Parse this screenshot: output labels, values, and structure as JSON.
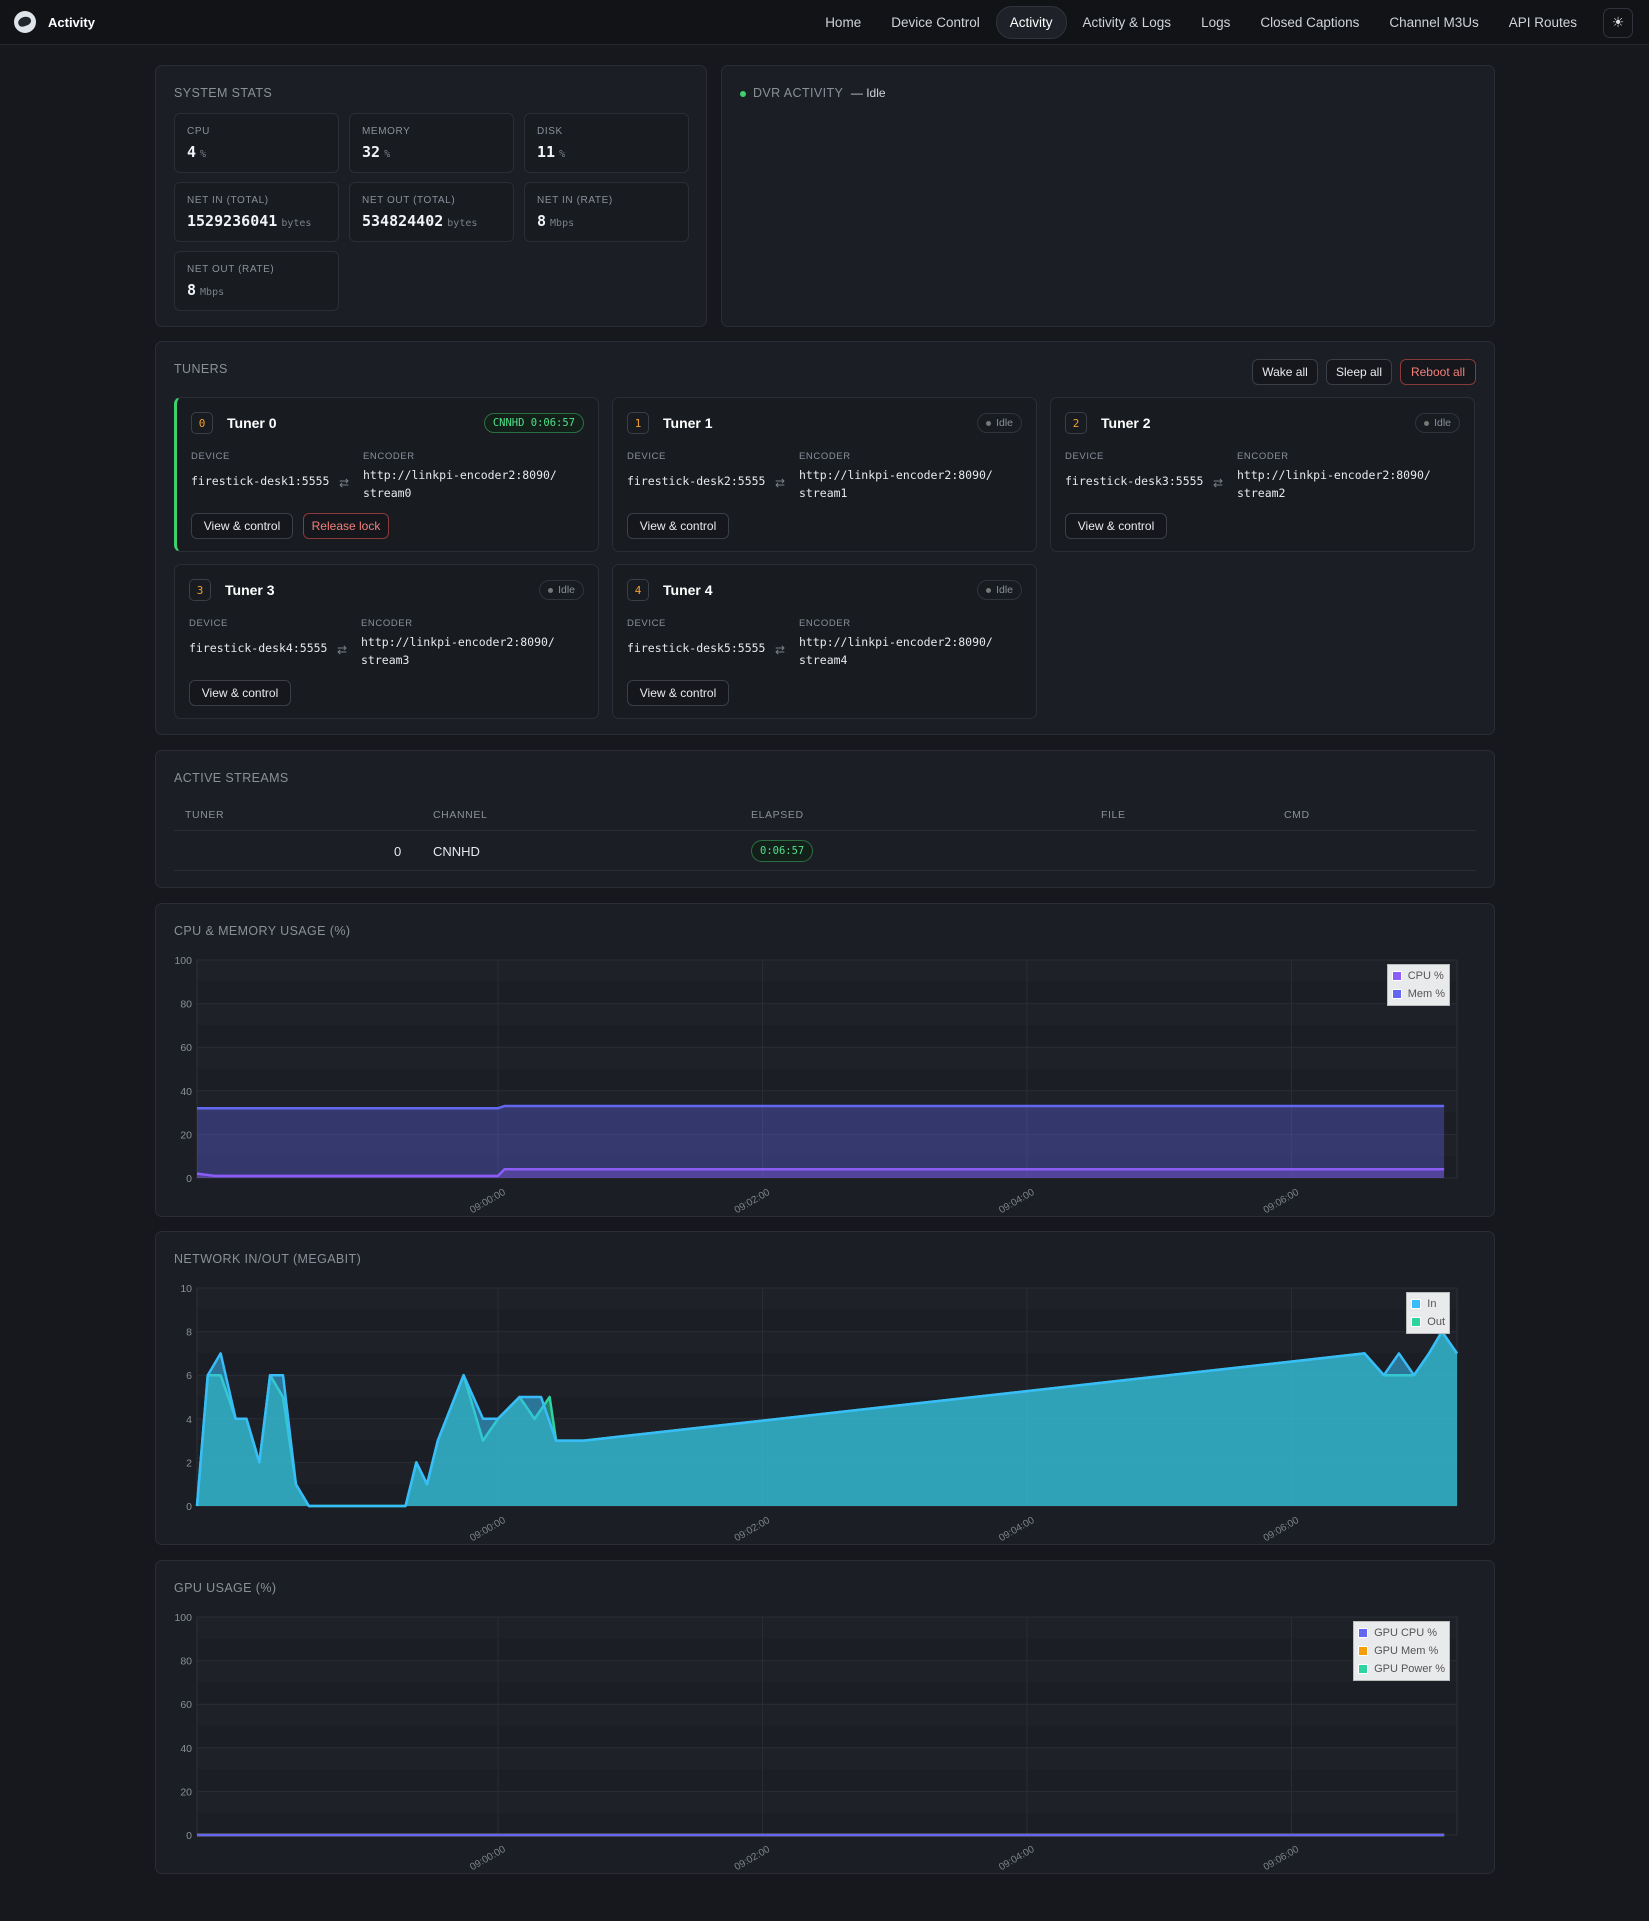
{
  "app": {
    "title": "Activity"
  },
  "nav": {
    "items": [
      "Home",
      "Device Control",
      "Activity",
      "Activity & Logs",
      "Logs",
      "Closed Captions",
      "Channel M3Us",
      "API Routes"
    ],
    "active": "Activity",
    "theme_icon": "sun-icon"
  },
  "system_stats": {
    "title": "System stats",
    "stats": [
      {
        "label": "CPU",
        "value": "4",
        "unit": "%"
      },
      {
        "label": "MEMORY",
        "value": "32",
        "unit": "%"
      },
      {
        "label": "DISK",
        "value": "11",
        "unit": "%"
      },
      {
        "label": "NET IN (TOTAL)",
        "value": "1529236041",
        "unit": "bytes"
      },
      {
        "label": "NET OUT (TOTAL)",
        "value": "534824402",
        "unit": "bytes"
      },
      {
        "label": "NET IN (RATE)",
        "value": "8",
        "unit": "Mbps"
      },
      {
        "label": "NET OUT (RATE)",
        "value": "8",
        "unit": "Mbps"
      }
    ]
  },
  "dvr": {
    "title": "DVR ACTIVITY",
    "status": "— Idle",
    "status_color": "#3ecf6e"
  },
  "tuners": {
    "title": "Tuners",
    "actions": {
      "wake_all": "Wake all",
      "sleep_all": "Sleep all",
      "reboot_all": "Reboot all"
    },
    "labels": {
      "device": "DEVICE",
      "encoder": "ENCODER",
      "view": "View & control",
      "release": "Release lock"
    },
    "list": [
      {
        "num": "0",
        "name": "Tuner 0",
        "status": "CNNHD 0:06:57",
        "device": "firestick-desk1:5555",
        "encoder_1": "http://linkpi-encoder2:8090/",
        "encoder_2": "stream0"
      },
      {
        "num": "1",
        "name": "Tuner 1",
        "status": "Idle",
        "device": "firestick-desk2:5555",
        "encoder_1": "http://linkpi-encoder2:8090/",
        "encoder_2": "stream1"
      },
      {
        "num": "2",
        "name": "Tuner 2",
        "status": "Idle",
        "device": "firestick-desk3:5555",
        "encoder_1": "http://linkpi-encoder2:8090/",
        "encoder_2": "stream2"
      },
      {
        "num": "3",
        "name": "Tuner 3",
        "status": "Idle",
        "device": "firestick-desk4:5555",
        "encoder_1": "http://linkpi-encoder2:8090/",
        "encoder_2": "stream3"
      },
      {
        "num": "4",
        "name": "Tuner 4",
        "status": "Idle",
        "device": "firestick-desk5:5555",
        "encoder_1": "http://linkpi-encoder2:8090/",
        "encoder_2": "stream4"
      }
    ]
  },
  "streams": {
    "title": "Active streams",
    "columns": [
      "TUNER",
      "CHANNEL",
      "ELAPSED",
      "FILE",
      "CMD"
    ],
    "rows": [
      {
        "tuner": "0",
        "channel": "CNNHD",
        "elapsed": "0:06:57",
        "file": "",
        "cmd": ""
      }
    ]
  },
  "chart_titles": [
    "CPU & Memory Usage (%)",
    "Network In/Out (Megabit)",
    "GPU Usage (%)"
  ],
  "chart_data": [
    {
      "type": "area",
      "title": "CPU & Memory Usage (%)",
      "x_ticks": [
        "09:00:00",
        "09:02:00",
        "09:04:00",
        "09:06:00"
      ],
      "ylim": [
        0,
        100
      ],
      "y_ticks": [
        0,
        20,
        40,
        60,
        80,
        100
      ],
      "grid": true,
      "legend": "top-right",
      "series": [
        {
          "name": "CPU %",
          "color": "#8b5cf6",
          "points": [
            [
              0,
              2
            ],
            [
              0.8,
              1
            ],
            [
              10,
              1
            ],
            [
              14,
              1
            ],
            [
              14.3,
              4
            ],
            [
              58,
              4
            ]
          ]
        },
        {
          "name": "Mem %",
          "color": "#6366f1",
          "points": [
            [
              0,
              32
            ],
            [
              10,
              32
            ],
            [
              14,
              32
            ],
            [
              14.3,
              33
            ],
            [
              58,
              33
            ]
          ]
        }
      ]
    },
    {
      "type": "area",
      "title": "Network In/Out (Megabit)",
      "x_ticks": [
        "09:00:00",
        "09:02:00",
        "09:04:00",
        "09:06:00"
      ],
      "ylim": [
        0,
        10
      ],
      "y_ticks": [
        0,
        2,
        4,
        6,
        8,
        10
      ],
      "grid": true,
      "legend": "top-right",
      "series": [
        {
          "name": "In",
          "color": "#38bdf8",
          "points": [
            [
              0,
              0
            ],
            [
              0.5,
              6
            ],
            [
              1.1,
              7
            ],
            [
              1.8,
              4
            ],
            [
              2.3,
              4
            ],
            [
              2.9,
              2
            ],
            [
              3.4,
              6
            ],
            [
              4.0,
              6
            ],
            [
              4.6,
              1
            ],
            [
              5.2,
              0
            ],
            [
              9.7,
              0
            ],
            [
              10.2,
              2
            ],
            [
              10.7,
              1
            ],
            [
              11.2,
              3
            ],
            [
              12.4,
              6
            ],
            [
              13.3,
              4
            ],
            [
              14.0,
              4
            ],
            [
              15.0,
              5
            ],
            [
              16.0,
              5
            ],
            [
              16.7,
              3
            ],
            [
              18.0,
              3
            ],
            [
              54.3,
              7
            ],
            [
              55.2,
              6
            ],
            [
              55.9,
              7
            ],
            [
              56.6,
              6
            ],
            [
              57.3,
              7
            ],
            [
              57.9,
              8
            ],
            [
              58.6,
              7
            ]
          ]
        },
        {
          "name": "Out",
          "color": "#2dd4a0",
          "points": [
            [
              0,
              0
            ],
            [
              0.5,
              6
            ],
            [
              1.1,
              6
            ],
            [
              1.8,
              4
            ],
            [
              2.3,
              4
            ],
            [
              2.9,
              2
            ],
            [
              3.4,
              6
            ],
            [
              4.0,
              5
            ],
            [
              4.6,
              1
            ],
            [
              5.2,
              0
            ],
            [
              9.7,
              0
            ],
            [
              10.2,
              2
            ],
            [
              10.7,
              1
            ],
            [
              11.2,
              3
            ],
            [
              12.4,
              6
            ],
            [
              13.3,
              3
            ],
            [
              14.0,
              4
            ],
            [
              15.0,
              5
            ],
            [
              15.7,
              4
            ],
            [
              16.4,
              5
            ],
            [
              16.7,
              3
            ],
            [
              18.0,
              3
            ],
            [
              54.3,
              7
            ],
            [
              55.2,
              6
            ],
            [
              56.0,
              6
            ],
            [
              56.6,
              6
            ],
            [
              57.3,
              7
            ],
            [
              57.9,
              8
            ],
            [
              58.6,
              7
            ]
          ]
        }
      ]
    },
    {
      "type": "line",
      "title": "GPU Usage (%)",
      "x_ticks": [
        "09:00:00",
        "09:02:00",
        "09:04:00",
        "09:06:00"
      ],
      "ylim": [
        0,
        100
      ],
      "y_ticks": [
        0,
        20,
        40,
        60,
        80,
        100
      ],
      "grid": true,
      "legend": "top-right",
      "series": [
        {
          "name": "GPU CPU %",
          "color": "#6366f1",
          "points": [
            [
              0,
              0
            ],
            [
              58,
              0
            ]
          ]
        },
        {
          "name": "GPU Mem %",
          "color": "#f59e0b",
          "points": [
            [
              0,
              0
            ],
            [
              58,
              0
            ]
          ]
        },
        {
          "name": "GPU Power %",
          "color": "#2dd4a0",
          "points": [
            [
              0,
              0
            ],
            [
              58,
              0
            ]
          ]
        }
      ]
    }
  ]
}
